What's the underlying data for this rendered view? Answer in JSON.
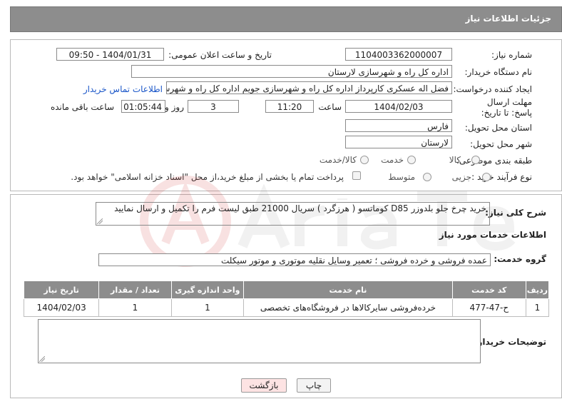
{
  "header": {
    "title": "جزئیات اطلاعات نیاز"
  },
  "form": {
    "need_number": {
      "label": "شماره نیاز:",
      "value": "1104003362000007"
    },
    "announce_datetime": {
      "label": "تاریخ و ساعت اعلان عمومی:",
      "value": "1404/01/31 - 09:50"
    },
    "buyer_org": {
      "label": "نام دستگاه خریدار:",
      "value": "اداره کل راه و شهرسازی لارستان"
    },
    "requester": {
      "label": "ایجاد کننده درخواست:",
      "value": "فضل اله عسکری کارپرداز اداره کل راه و شهرسازی جویم اداره کل راه و شهرسازی ل",
      "contact_link": "اطلاعات تماس خریدار"
    },
    "deadline": {
      "label": "مهلت ارسال پاسخ: تا تاریخ:",
      "date": "1404/02/03",
      "time_label": "ساعت",
      "time": "11:20",
      "days": "3",
      "days_label": "روز و",
      "remaining": "01:05:44",
      "remaining_label": "ساعت باقی مانده"
    },
    "delivery_province": {
      "label": "استان محل تحویل:",
      "value": "فارس"
    },
    "delivery_city": {
      "label": "شهر محل تحویل:",
      "value": "لارستان"
    },
    "category": {
      "label": "طبقه بندی موضوعی:",
      "options": [
        "کالا",
        "خدمت",
        "کالا/خدمت"
      ]
    },
    "process": {
      "label": "نوع فرآیند خرید :",
      "options": [
        "جزیی",
        "متوسط"
      ],
      "payment_note": "پرداخت تمام یا بخشی از مبلغ خرید،از محل \"اسناد خزانه اسلامی\" خواهد بود."
    }
  },
  "summary": {
    "label": "شرح کلی نیاز:",
    "text": "خرید چرخ جلو بلدوزر D85 کوماتسو  ( هرزگرد  )  سریال 21000  طبق لیست فرم را تکمیل و ارسال نمایید"
  },
  "services": {
    "section_title": "اطلاعات خدمات مورد نیاز",
    "group_label": "گروه خدمت:",
    "group_value": "عمده فروشی و خرده فروشی ؛ تعمیر وسایل نقلیه موتوری و موتور سیکلت",
    "columns": [
      "ردیف",
      "کد خدمت",
      "نام خدمت",
      "واحد اندازه گیری",
      "تعداد / مقدار",
      "تاریخ نیاز"
    ],
    "rows": [
      [
        "1",
        "ح-47-477",
        "خرده‌فروشی سایرکالاها در فروشگاه‌های تخصصی",
        "1",
        "1",
        "1404/02/03"
      ]
    ]
  },
  "buyer_notes": {
    "label": "توضیحات خریدار:",
    "value": ""
  },
  "buttons": {
    "print": "چاپ",
    "back": "بازگشت"
  },
  "colors": {
    "header": "#8d8d8d",
    "link": "#1a56c8",
    "back_button": "#fde3e3"
  }
}
